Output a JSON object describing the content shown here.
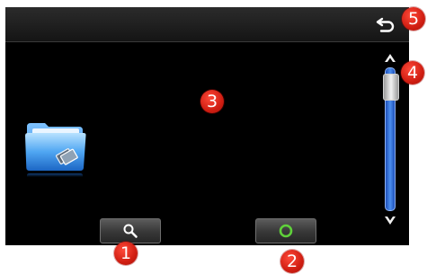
{
  "toolbar": {
    "back_icon": "return-arrow-icon"
  },
  "main": {
    "folder_icon": "folder-icon"
  },
  "scrollbar": {
    "up_icon": "chevron-up-icon",
    "down_icon": "chevron-down-icon",
    "position": 0.05
  },
  "bottom_bar": {
    "search_icon": "search-icon",
    "ok_icon": "green-circle-icon"
  },
  "markers": [
    "1",
    "2",
    "3",
    "4",
    "5"
  ],
  "colors": {
    "screen_bg": "#000000",
    "title_bar": "#1f1f1f",
    "scroll_track": "#3a7be0",
    "ok_ring": "#5fd13a",
    "marker": "#e0261a"
  }
}
